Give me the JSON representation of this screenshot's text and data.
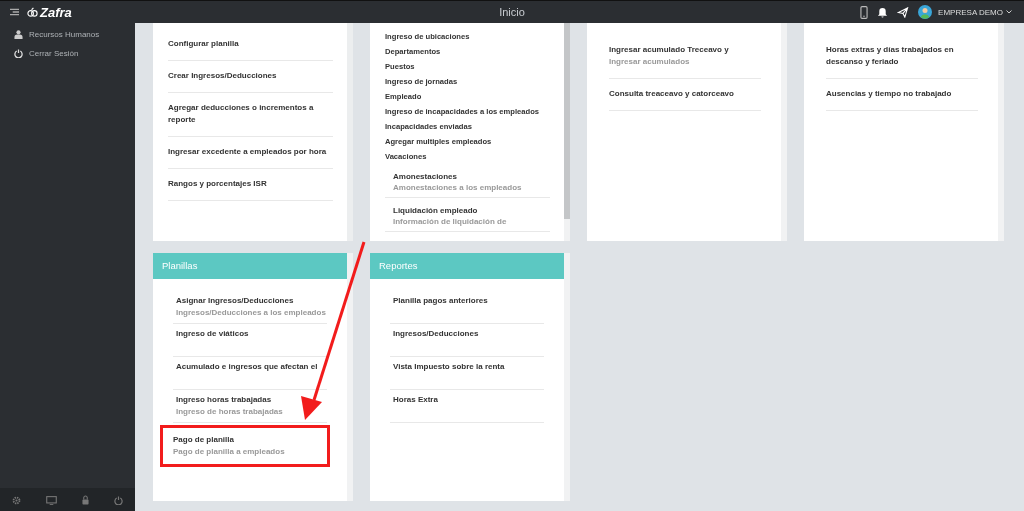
{
  "topbar": {
    "app_name": "Zafra",
    "title": "Inicio",
    "user": "EMPRESA DEMO"
  },
  "sidebar": {
    "items": [
      {
        "label": "Recursos Humanos",
        "kind": "user"
      },
      {
        "label": "Cerrar Sesión",
        "kind": "power"
      }
    ]
  },
  "top_cards": [
    {
      "items": [
        {
          "title": "Configurar planilla",
          "kind": "detail"
        },
        {
          "title": "Crear Ingresos/Deducciones",
          "kind": "detail"
        },
        {
          "title": "Agregar deducciones o incrementos a reporte",
          "kind": "detail"
        },
        {
          "title": "Ingresar excedente a empleados por hora",
          "kind": "detail"
        },
        {
          "title": "Rangos y porcentajes ISR",
          "kind": "detail"
        }
      ]
    },
    {
      "items": [
        {
          "title": "Ingreso de ubicaciones",
          "kind": "plain"
        },
        {
          "title": "Departamentos",
          "kind": "plain"
        },
        {
          "title": "Puestos",
          "kind": "plain"
        },
        {
          "title": "Ingreso de jornadas",
          "kind": "plain"
        },
        {
          "title": "Empleado",
          "kind": "plain"
        },
        {
          "title": "Ingreso de incapacidades a los empleados",
          "kind": "plain"
        },
        {
          "title": "Incapacidades enviadas",
          "kind": "plain"
        },
        {
          "title": "Agregar multiples empleados",
          "kind": "plain"
        },
        {
          "title": "Vacaciones",
          "kind": "plain"
        },
        {
          "title": "Amonestaciones",
          "subtitle": "Amonestaciones a los empleados",
          "kind": "sub"
        },
        {
          "title": "Liquidación empleado",
          "subtitle": "Información de liquidación de",
          "kind": "sub"
        }
      ]
    },
    {
      "items": [
        {
          "title": "Ingresar acumulado Treceavo y",
          "subtitle": "Ingresar acumulados",
          "kind": "detail"
        },
        {
          "title": "Consulta treaceavo y catorceavo",
          "kind": "detail"
        }
      ]
    },
    {
      "items": [
        {
          "title": "Horas extras y días trabajados en descanso y feriado",
          "kind": "detail"
        },
        {
          "title": "Ausencias y tiempo no trabajado",
          "kind": "detail"
        }
      ]
    }
  ],
  "bottom_cards": [
    {
      "title": "Planillas",
      "items": [
        {
          "title": "Asignar Ingresos/Deducciones",
          "subtitle": "Ingresos/Deducciones a los empleados",
          "highlighted": false
        },
        {
          "title": "Ingreso de viáticos",
          "highlighted": false
        },
        {
          "title": "Acumulado e ingresos que afectan el",
          "highlighted": false
        },
        {
          "title": "Ingreso horas trabajadas",
          "subtitle": "Ingreso de horas trabajadas",
          "highlighted": false
        },
        {
          "title": "Pago de planilla",
          "subtitle": "Pago de planilla a empleados",
          "highlighted": true
        }
      ]
    },
    {
      "title": "Reportes",
      "items": [
        {
          "title": "Planilla pagos anteriores",
          "highlighted": false
        },
        {
          "title": "Ingresos/Deducciones",
          "highlighted": false
        },
        {
          "title": "Vista Impuesto sobre la renta",
          "highlighted": false
        },
        {
          "title": "Horas Extra",
          "highlighted": false
        }
      ]
    }
  ]
}
